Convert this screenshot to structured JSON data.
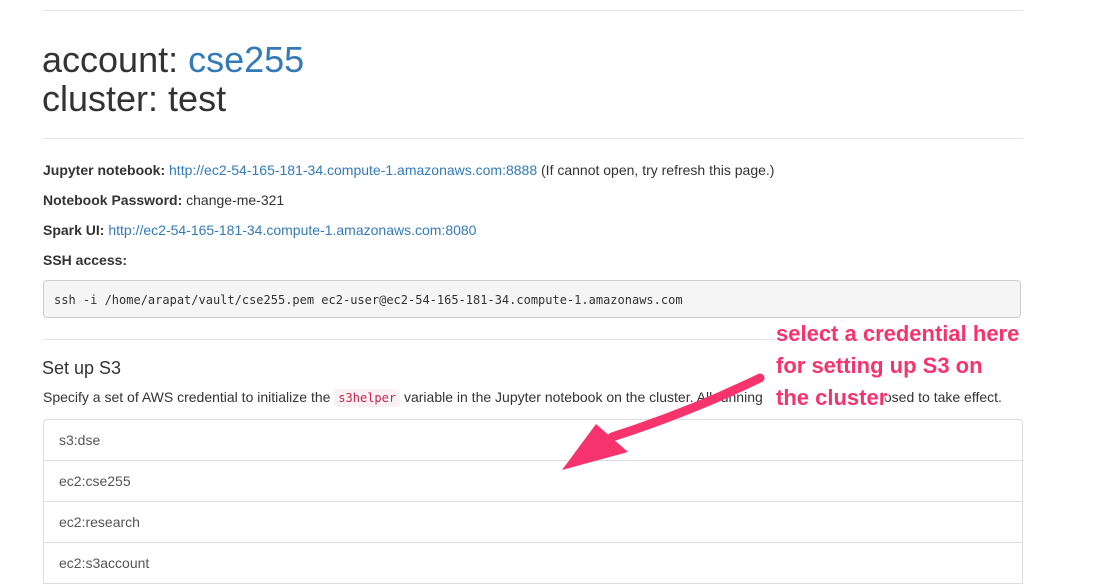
{
  "header": {
    "account_label": "account: ",
    "account_name": "cse255",
    "cluster_label": "cluster: ",
    "cluster_name": "test"
  },
  "info": {
    "jupyter_label": "Jupyter notebook:",
    "jupyter_url": "http://ec2-54-165-181-34.compute-1.amazonaws.com:8888",
    "jupyter_note": "(If cannot open, try refresh this page.)",
    "password_label": "Notebook Password:",
    "password_value": "change-me-321",
    "spark_label": "Spark UI:",
    "spark_url": "http://ec2-54-165-181-34.compute-1.amazonaws.com:8080",
    "ssh_label": "SSH access:",
    "ssh_command": "ssh -i /home/arapat/vault/cse255.pem ec2-user@ec2-54-165-181-34.compute-1.amazonaws.com"
  },
  "s3": {
    "heading": "Set up S3",
    "desc_before": "Specify a set of AWS credential to initialize the ",
    "desc_code": "s3helper",
    "desc_after": " variable in the Jupyter notebook on the cluster. All running",
    "desc_tail": "losed to take effect.",
    "credentials": [
      "s3:dse",
      "ec2:cse255",
      "ec2:research",
      "ec2:s3account"
    ]
  },
  "annotation": {
    "lines": [
      "select a credential here",
      "for setting up S3 on",
      "the cluster"
    ],
    "color": "#f7336e"
  },
  "colors": {
    "link": "#337ab7",
    "code_text": "#c7254e",
    "code_bg": "#f9f2f4"
  }
}
